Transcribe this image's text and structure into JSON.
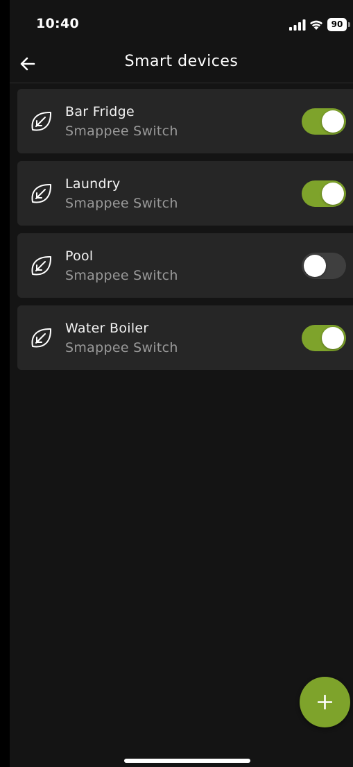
{
  "status_bar": {
    "time": "10:40",
    "battery": "90",
    "icons": [
      "signal-icon",
      "wifi-icon",
      "battery-icon"
    ]
  },
  "nav": {
    "back_icon": "arrow-left-icon",
    "title": "Smart devices"
  },
  "devices": [
    {
      "name": "Bar Fridge",
      "type": "Smappee Switch",
      "icon": "leaf-icon",
      "enabled": true
    },
    {
      "name": "Laundry",
      "type": "Smappee Switch",
      "icon": "leaf-icon",
      "enabled": true
    },
    {
      "name": "Pool",
      "type": "Smappee Switch",
      "icon": "leaf-icon",
      "enabled": false
    },
    {
      "name": "Water Boiler",
      "type": "Smappee Switch",
      "icon": "leaf-icon",
      "enabled": true
    }
  ],
  "fab": {
    "icon": "plus-icon"
  },
  "colors": {
    "accent": "#7ea32b",
    "background": "#141414",
    "card": "#262626",
    "toggle_off": "#3f3f3f"
  }
}
